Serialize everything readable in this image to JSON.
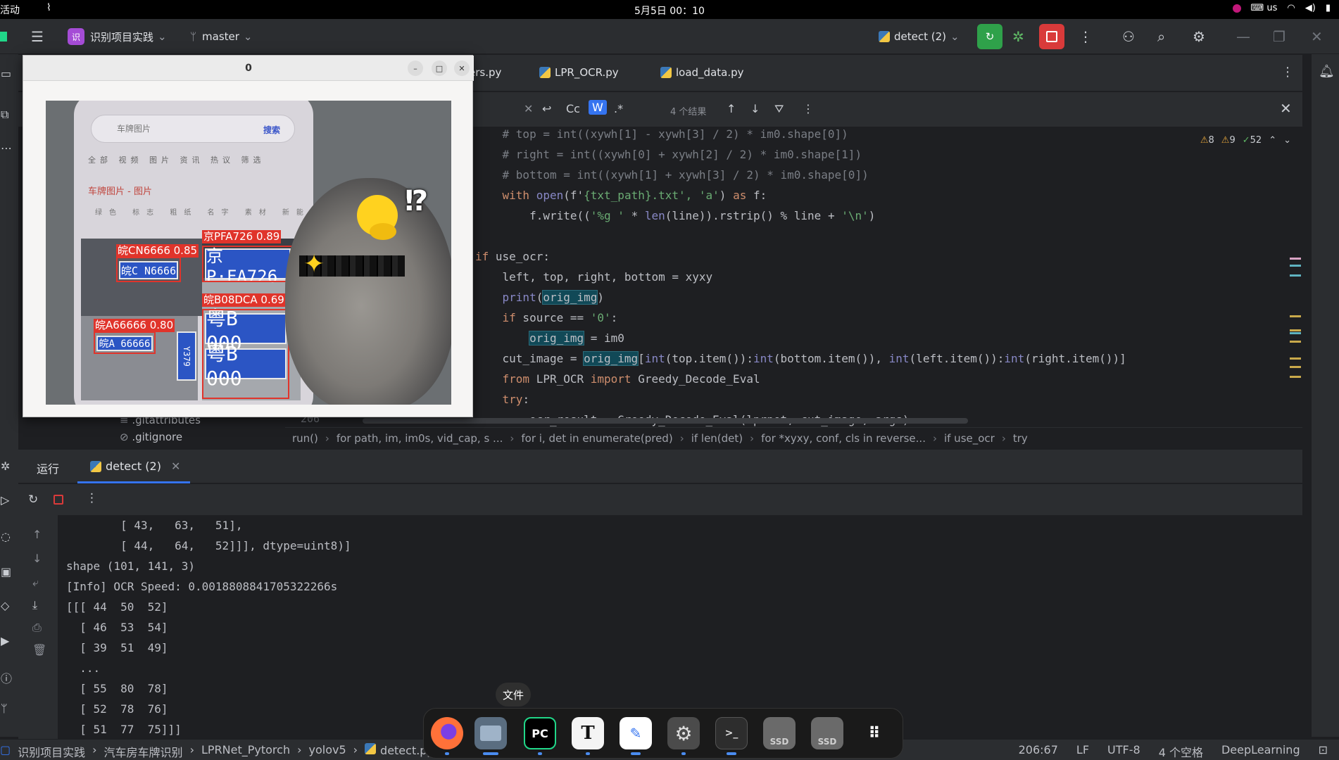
{
  "topbar": {
    "activities": "活动",
    "clock": "5月5日 00：10",
    "input_method": "us"
  },
  "titlebar": {
    "project_badge": "识",
    "project_name": "识别项目实践",
    "branch": "master",
    "run_config": "detect (2)"
  },
  "editor_tabs": [
    {
      "label": "ers.py"
    },
    {
      "label": "LPR_OCR.py"
    },
    {
      "label": "load_data.py"
    }
  ],
  "find": {
    "case_label": "Cc",
    "word_label": "W",
    "regex_label": ".*",
    "results": "4 个结果"
  },
  "inspections": {
    "warnings1": "8",
    "warnings2": "9",
    "ok": "52"
  },
  "gutter": {
    "line": "206"
  },
  "project_files": [
    ".gitattributes",
    ".gitignore"
  ],
  "breadcrumbs": [
    "run()",
    "for path, im, im0s, vid_cap, s ...",
    "for i, det in enumerate(pred)",
    "if len(det)",
    "for *xyxy, conf, cls in reverse...",
    "if use_ocr",
    "try"
  ],
  "run_panel": {
    "title": "运行",
    "tab": "detect (2)",
    "console": "        [ 43,   63,   51],\n        [ 44,   64,   52]]], dtype=uint8)]\nshape (101, 141, 3)\n[Info] OCR Speed: 0.0018808841705322266s\n[[[ 44  50  52]\n  [ 46  53  54]\n  [ 39  51  49]\n  ...\n  [ 55  80  78]\n  [ 52  78  76]\n  [ 51  77  75]]]"
  },
  "statusbar": {
    "path": [
      "识别项目实践",
      "汽车房车牌识别",
      "LPRNet_Pytorch",
      "yolov5",
      "detect.py"
    ],
    "position": "206:67",
    "line_sep": "LF",
    "encoding": "UTF-8",
    "indent": "4 个空格",
    "interpreter": "DeepLearning"
  },
  "dock": {
    "tooltip": "文件",
    "pycharm_label": "PC",
    "text_editor_label": "T",
    "ssd1": "SSD",
    "ssd2": "SSD"
  },
  "popup": {
    "title": "0",
    "phone_search": "车牌图片",
    "phone_search_btn": "搜索",
    "phone_tabs": "全部 视频 图片 资讯 热议 筛选",
    "phone_sub": "车牌图片 - 图片",
    "phone_chips": "绿色 标志 粗纸 名字 素材 新能",
    "detections": [
      {
        "label": "京PFA726 0.89",
        "plate": "京P·FA726"
      },
      {
        "label": "皖CN6666 0.85",
        "plate": "皖C N6666"
      },
      {
        "label": "皖B08DCA 0.69",
        "plate": "粤B 000"
      },
      {
        "label": "皖A66666 0.80",
        "plate": "皖A 66666"
      }
    ],
    "plate_extra": "粤B 000",
    "plate_side": "Y379",
    "exclaim": "⁉"
  },
  "code_lines": [
    {
      "parts": [
        [
          "cm",
          "    # top = int((xywh[1] - xywh[3] / 2) * im0.shape[0])"
        ]
      ]
    },
    {
      "parts": [
        [
          "cm",
          "    # right = int((xywh[0] + xywh[2] / 2) * im0.shape[1])"
        ]
      ]
    },
    {
      "parts": [
        [
          "cm",
          "    # bottom = int((xywh[1] + xywh[3] / 2) * im0.shape[0])"
        ]
      ]
    },
    {
      "parts": [
        [
          "kw",
          "    with "
        ],
        [
          "bi",
          "open"
        ],
        [
          "",
          "(f'"
        ],
        [
          "st",
          "{txt_path}.txt"
        ],
        [
          "st",
          "', 'a'"
        ],
        [
          "",
          ") "
        ],
        [
          "kw",
          "as"
        ],
        [
          "",
          " f:"
        ]
      ]
    },
    {
      "parts": [
        [
          "",
          "        f.write(("
        ],
        [
          "st",
          "'%g '"
        ],
        [
          "",
          " * "
        ],
        [
          "bi",
          "len"
        ],
        [
          "",
          "(line)).rstrip() % line + "
        ],
        [
          "st",
          "'\\n'"
        ],
        [
          "",
          ")"
        ]
      ]
    },
    {
      "parts": [
        [
          "",
          ""
        ]
      ]
    },
    {
      "parts": [
        [
          "kw",
          "if"
        ],
        [
          "",
          " use_ocr:"
        ]
      ]
    },
    {
      "parts": [
        [
          "",
          "    left, top, right, bottom = xyxy"
        ]
      ]
    },
    {
      "parts": [
        [
          "bi",
          "    print"
        ],
        [
          "",
          "("
        ],
        [
          "hl",
          "orig_img"
        ],
        [
          "",
          ")"
        ]
      ]
    },
    {
      "parts": [
        [
          "kw",
          "    if"
        ],
        [
          "",
          " source == "
        ],
        [
          "st",
          "'0'"
        ],
        [
          "",
          ":"
        ]
      ]
    },
    {
      "parts": [
        [
          "",
          "        "
        ],
        [
          "hl",
          "orig_img"
        ],
        [
          "",
          " = im0"
        ]
      ]
    },
    {
      "parts": [
        [
          "",
          "    cut_image = "
        ],
        [
          "hl",
          "orig_img"
        ],
        [
          "",
          "["
        ],
        [
          "bi",
          "int"
        ],
        [
          "",
          "(top.item()):"
        ],
        [
          "bi",
          "int"
        ],
        [
          "",
          "(bottom.item()), "
        ],
        [
          "bi",
          "int"
        ],
        [
          "",
          "(left.item()):"
        ],
        [
          "bi",
          "int"
        ],
        [
          "",
          "(right.item())]"
        ]
      ]
    },
    {
      "parts": [
        [
          "kw",
          "    from"
        ],
        [
          "",
          " LPR_OCR "
        ],
        [
          "kw",
          "import"
        ],
        [
          "",
          " Greedy_Decode_Eval"
        ]
      ]
    },
    {
      "parts": [
        [
          "kw",
          "    try"
        ],
        [
          "",
          ":"
        ]
      ]
    },
    {
      "parts": [
        [
          "",
          "        ocr_result = Greedy_Decode_Eval(lprnet, cut_image, args)"
        ]
      ]
    }
  ]
}
